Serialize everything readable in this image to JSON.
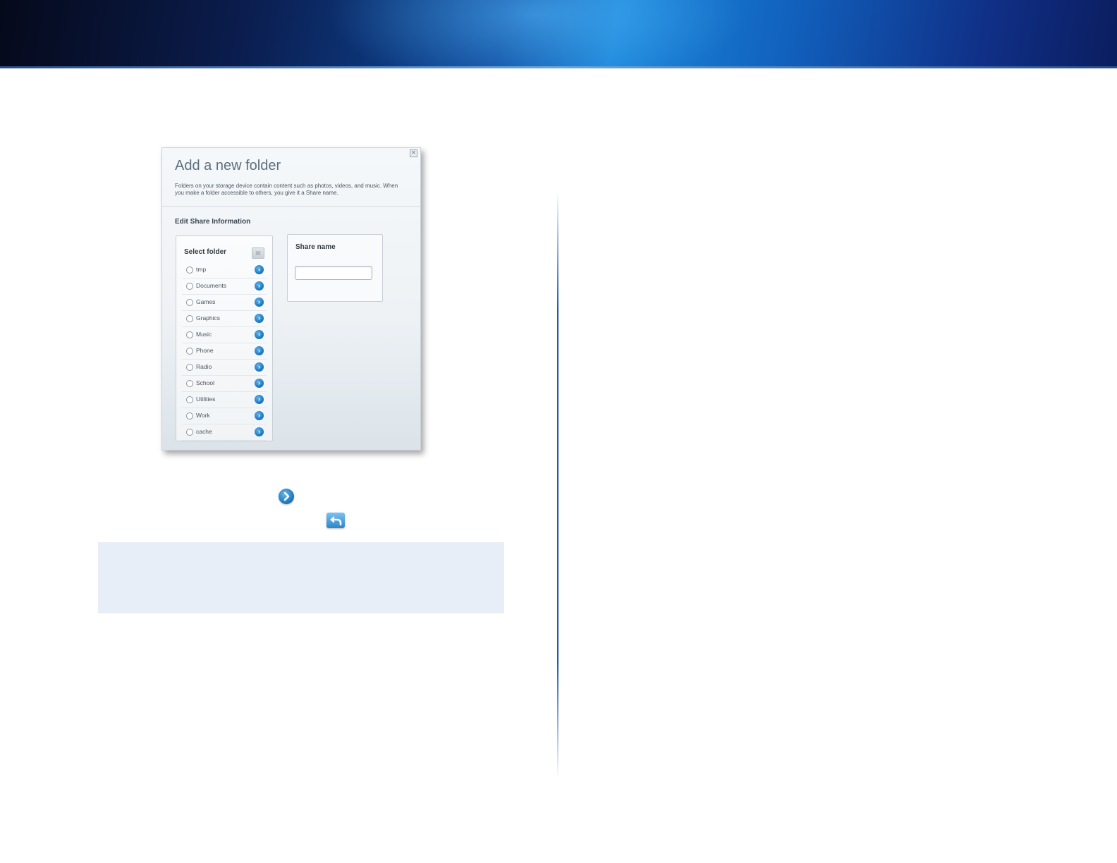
{
  "dialog": {
    "title": "Add a new folder",
    "description": "Folders on your storage device contain content such as photos, videos, and music. When you make a folder accessible to others, you give it a Share name.",
    "section_label": "Edit Share Information",
    "close_icon": "close-icon",
    "folder_panel": {
      "title": "Select folder",
      "folders": [
        "tmp",
        "Documents",
        "Games",
        "Graphics",
        "Music",
        "Phone",
        "Radio",
        "School",
        "Utilities",
        "Work",
        "cache"
      ]
    },
    "share_panel": {
      "title": "Share name",
      "input_value": ""
    }
  },
  "icons": {
    "forward": "chevron-right-circle-icon",
    "back": "back-arrow-icon"
  },
  "colors": {
    "accent_blue": "#1672bb",
    "note_bg": "#e8eef8"
  }
}
